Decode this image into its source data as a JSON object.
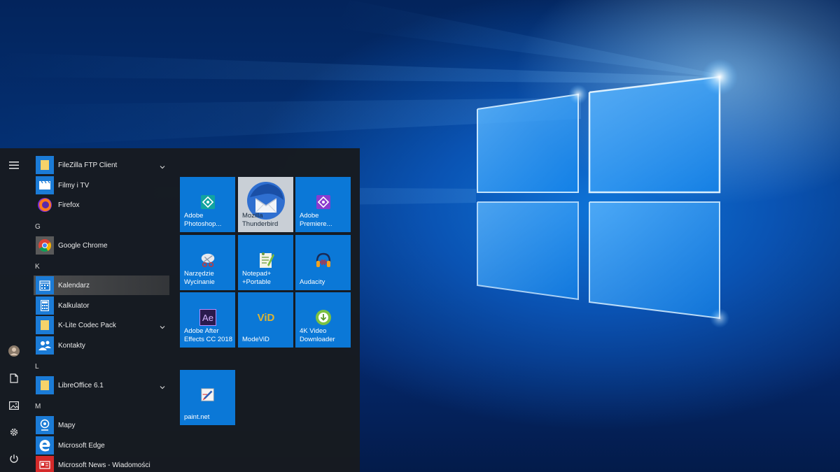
{
  "rail": {
    "menu_icon": "hamburger-icon",
    "user_icon": "user-avatar-icon",
    "documents_icon": "document-icon",
    "pictures_icon": "picture-icon",
    "settings_icon": "gear-icon",
    "power_icon": "power-icon"
  },
  "app_list": {
    "items": [
      {
        "label": "FileZilla FTP Client",
        "icon": "folder-icon",
        "expandable": true
      },
      {
        "label": "Filmy i TV",
        "icon": "film-icon"
      },
      {
        "label": "Firefox",
        "icon": "firefox-icon"
      },
      {
        "letter": "G"
      },
      {
        "label": "Google Chrome",
        "icon": "chrome-icon"
      },
      {
        "letter": "K"
      },
      {
        "label": "Kalendarz",
        "icon": "calendar-icon",
        "selected": true
      },
      {
        "label": "Kalkulator",
        "icon": "calculator-icon"
      },
      {
        "label": "K-Lite Codec Pack",
        "icon": "folder-icon",
        "expandable": true
      },
      {
        "label": "Kontakty",
        "icon": "contacts-icon"
      },
      {
        "letter": "L"
      },
      {
        "label": "LibreOffice 6.1",
        "icon": "folder-icon",
        "expandable": true
      },
      {
        "letter": "M"
      },
      {
        "label": "Mapy",
        "icon": "maps-icon"
      },
      {
        "label": "Microsoft Edge",
        "icon": "edge-icon"
      },
      {
        "label": "Microsoft News - Wiadomości",
        "icon": "news-icon"
      }
    ]
  },
  "tiles": [
    {
      "label": "Adobe\nPhotoshop...",
      "icon": "photoshop-icon"
    },
    {
      "label": "Mozilla\nThunderbird",
      "icon": "thunderbird-icon",
      "light": true
    },
    {
      "label": "Adobe\nPremiere...",
      "icon": "premiere-icon"
    },
    {
      "label": "Narzędzie\nWycinanie",
      "icon": "snipping-tool-icon"
    },
    {
      "label": "Notepad+\n+Portable",
      "icon": "notepad-plus-plus-icon"
    },
    {
      "label": "Audacity",
      "icon": "audacity-icon"
    },
    {
      "label": "Adobe After\nEffects CC 2018",
      "icon": "after-effects-icon",
      "icon_text": "Ae"
    },
    {
      "label": "ModeViD",
      "icon": "modevid-icon",
      "icon_text": "ViD"
    },
    {
      "label": "4K Video\nDownloader",
      "icon": "video-downloader-icon"
    },
    {
      "label": "paint.net",
      "icon": "paint-net-icon"
    }
  ],
  "colors": {
    "menu_bg": "#171b20",
    "tile_blue": "#0b78d7",
    "accent": "#0078d7"
  }
}
